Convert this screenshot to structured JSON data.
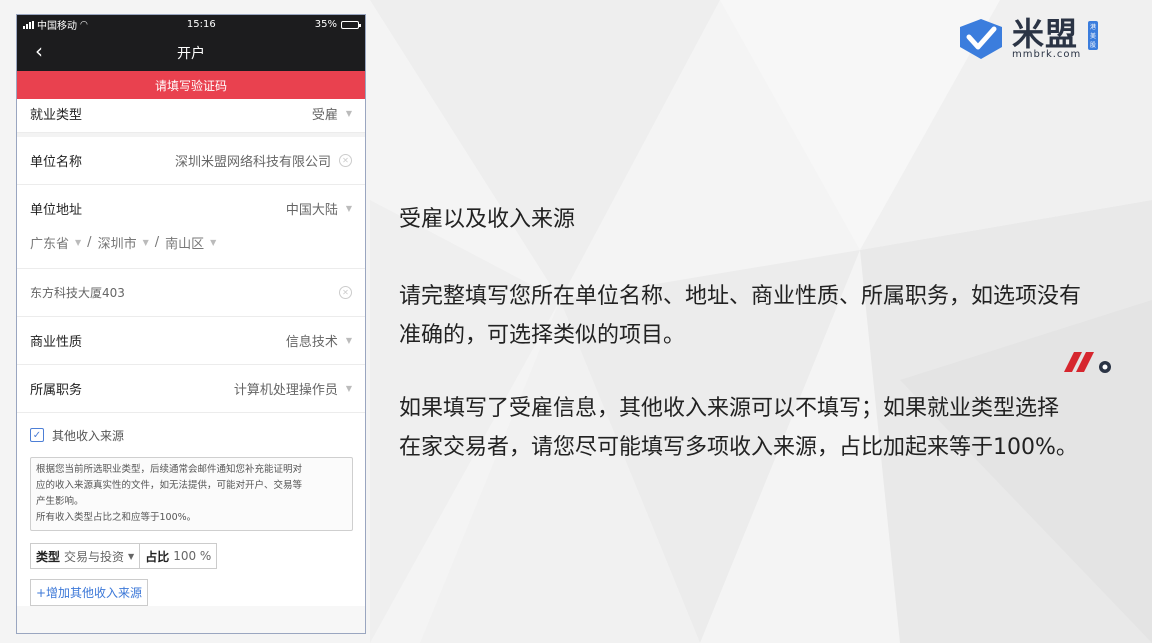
{
  "status_bar": {
    "carrier": "中国移动",
    "time": "15:16",
    "battery": "35%",
    "battery_level": 0.35
  },
  "nav": {
    "title": "开户"
  },
  "alert": {
    "text": "请填写验证码"
  },
  "form": {
    "employment_type": {
      "label": "就业类型",
      "value": "受雇"
    },
    "company_name": {
      "label": "单位名称",
      "value": "深圳米盟网络科技有限公司"
    },
    "company_address": {
      "label": "单位地址",
      "country": "中国大陆",
      "province": "广东省",
      "city": "深圳市",
      "district": "南山区",
      "separator": "/"
    },
    "street": {
      "value": "东方科技大厦403"
    },
    "business_nature": {
      "label": "商业性质",
      "value": "信息技术"
    },
    "position": {
      "label": "所属职务",
      "value": "计算机处理操作员"
    }
  },
  "other_income": {
    "checkbox_label": "其他收入来源",
    "checked": true,
    "notice_line1": "根据您当前所选职业类型，后续通常会邮件通知您补充能证明对",
    "notice_line2": "应的收入来源真实性的文件，如无法提供，可能对开户、交易等",
    "notice_line3": "产生影响。",
    "notice_line4": "所有收入类型占比之和应等于100%。",
    "type_label": "类型",
    "type_value": "交易与投资",
    "ratio_label": "占比",
    "ratio_value": "100 %",
    "add_button": "+增加其他收入来源"
  },
  "logo": {
    "text": "米盟",
    "tag": "港美股",
    "url": "mmbrk.com"
  },
  "content": {
    "heading": "受雇以及收入来源",
    "para1_line1": "请完整填写您所在单位名称、地址、商业性质、所属职务，如选项没有",
    "para1_line2": "准确的，可选择类似的项目。",
    "para2_line1": "如果填写了受雇信息，其他收入来源可以不填写；如果就业类型选择",
    "para2_line2": "在家交易者，请您尽可能填写多项收入来源，占比加起来等于100%。"
  },
  "colors": {
    "alert_red": "#e9414f",
    "logo_blue": "#3b7ddd",
    "mark_red": "#d6262e",
    "link_blue": "#3c78d8"
  },
  "icons": [
    "signal-icon",
    "wifi-icon",
    "battery-icon",
    "back-icon",
    "chevron-down-icon",
    "clear-icon",
    "checkbox-checked-icon",
    "logo-icon",
    "brand-mark-icon"
  ]
}
